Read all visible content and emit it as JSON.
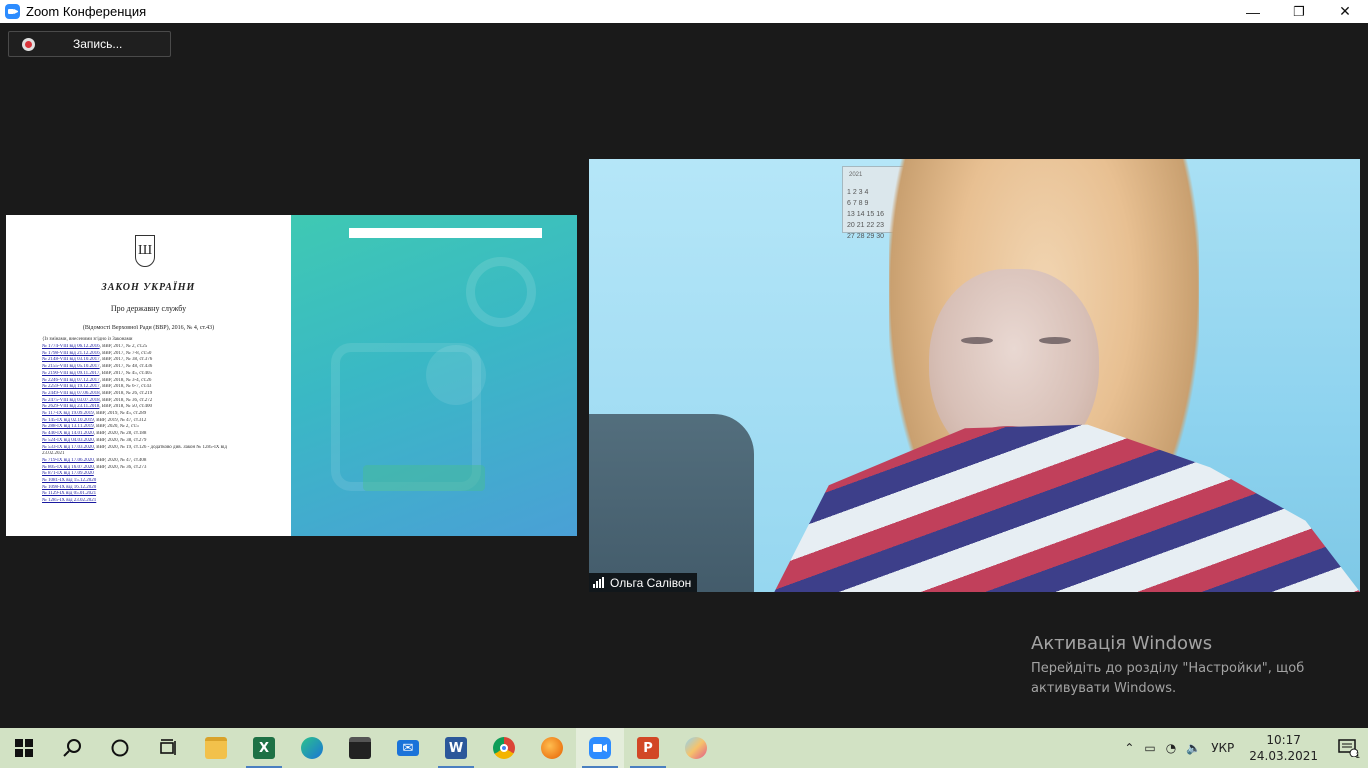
{
  "window": {
    "title": "Zoom Конференция",
    "minimize": "—",
    "maximize": "❐",
    "close": "✕"
  },
  "recording": {
    "label": "Запись..."
  },
  "document": {
    "title": "ЗАКОН УКРАЇНИ",
    "subtitle": "Про державну службу",
    "source": "(Відомості Верховної Ради (ВВР), 2016, № 4, ст.43)",
    "amendments_heading": "{Із змінами, внесеними згідно із Законами",
    "amendments": [
      {
        "link": "№ 1774-VIII від 06.12.2016",
        "text": ", ВВР, 2017, № 2, ст.25"
      },
      {
        "link": "№ 1798-VIII від 21.12.2016",
        "text": ", ВВР, 2017, № 7-8, ст.50"
      },
      {
        "link": "№ 2148-VIII від 03.10.2017",
        "text": ", ВВР, 2017, № 38, ст.376"
      },
      {
        "link": "№ 2155-VIII від 05.10.2017",
        "text": ", ВВР, 2017, № 48, ст.436"
      },
      {
        "link": "№ 2190-VIII від 09.11.2017",
        "text": ", ВВР, 2017, № 45, ст.405"
      },
      {
        "link": "№ 2246-VIII від 07.12.2017",
        "text": ", ВВР, 2018, № 3-4, ст.26"
      },
      {
        "link": "№ 2259-VIII від 19.12.2017",
        "text": ", ВВР, 2018, № 6-7, ст.43"
      },
      {
        "link": "№ 2449-VIII від 07.06.2018",
        "text": ", ВВР, 2018, № 26, ст.219"
      },
      {
        "link": "№ 2475-VIII від 03.07.2018",
        "text": ", ВВР, 2018, № 36, ст.272"
      },
      {
        "link": "№ 2629-VIII від 23.11.2018",
        "text": ", ВВР, 2018, № 50, ст.400"
      },
      {
        "link": "№ 117-IX від 19.09.2019",
        "text": ", ВВР, 2019, № 45, ст.289"
      },
      {
        "link": "№ 145-IX від 02.10.2019",
        "text": ", ВВР, 2019, № 47, ст.312"
      },
      {
        "link": "№ 288-IX від 13.11.2019",
        "text": ", ВВР, 2020, № 2, ст.5"
      },
      {
        "link": "№ 440-IX від 14.01.2020",
        "text": ", ВВР, 2020, № 28, ст.188"
      },
      {
        "link": "№ 524-IX від 04.03.2020",
        "text": ", ВВР, 2020, № 38, ст.279"
      },
      {
        "link": "№ 533-IX від 17.03.2020",
        "text": ", ВВР, 2020, № 19, ст.126 - додатково див. Закон № 1285-IX від"
      },
      {
        "link": "",
        "text": "23.02.2021"
      },
      {
        "link": "№ 719-IX від 17.06.2020",
        "text": ", ВВР, 2020, № 47, ст.408"
      },
      {
        "link": "№ 805-IX від 16.07.2020",
        "text": ", ВВР, 2020, № 36, ст.273"
      },
      {
        "link": "№ 871-IX від 17.09.2020",
        "text": ""
      },
      {
        "link": "№ 1081-IX від 15.12.2020",
        "text": ""
      },
      {
        "link": "№ 1098-IX від 16.12.2020",
        "text": ""
      },
      {
        "link": "№ 1129-IX від 05.01.2021",
        "text": ""
      },
      {
        "link": "№ 1285-IX від 23.02.2021",
        "text": ""
      }
    ]
  },
  "calendar": {
    "title": "2021",
    "rows": [
      "1   2   3   4",
      "6   7   8   9",
      "13  14  15  16",
      "20  21  22  23",
      "27  28  29  30"
    ]
  },
  "participant": {
    "name": "Ольга Салівон"
  },
  "activation": {
    "title": "Активація Windows",
    "line1": "Перейдіть до розділу \"Настройки\", щоб",
    "line2": "активувати Windows."
  },
  "taskbar": {
    "apps": [
      {
        "name": "start",
        "icon": "windows-logo"
      },
      {
        "name": "search",
        "icon": "search-icon"
      },
      {
        "name": "cortana",
        "icon": "cortana-circle-icon"
      },
      {
        "name": "task-view",
        "icon": "task-view-icon"
      },
      {
        "name": "file-explorer",
        "icon": "folder-icon"
      },
      {
        "name": "excel",
        "icon": "excel-icon"
      },
      {
        "name": "edge",
        "icon": "edge-icon"
      },
      {
        "name": "store",
        "icon": "store-icon"
      },
      {
        "name": "mail",
        "icon": "mail-icon"
      },
      {
        "name": "word",
        "icon": "word-icon"
      },
      {
        "name": "chrome",
        "icon": "chrome-icon"
      },
      {
        "name": "firefox",
        "icon": "firefox-icon"
      },
      {
        "name": "zoom",
        "icon": "zoom-icon"
      },
      {
        "name": "powerpoint",
        "icon": "powerpoint-icon"
      },
      {
        "name": "paint",
        "icon": "paint-icon"
      }
    ],
    "language": "УКР",
    "time": "10:17",
    "date": "24.03.2021",
    "notification_count": "1"
  },
  "colors": {
    "zoom_blue": "#2d8cff",
    "background": "#1a1a1a",
    "taskbar": "#d2e2c4"
  }
}
